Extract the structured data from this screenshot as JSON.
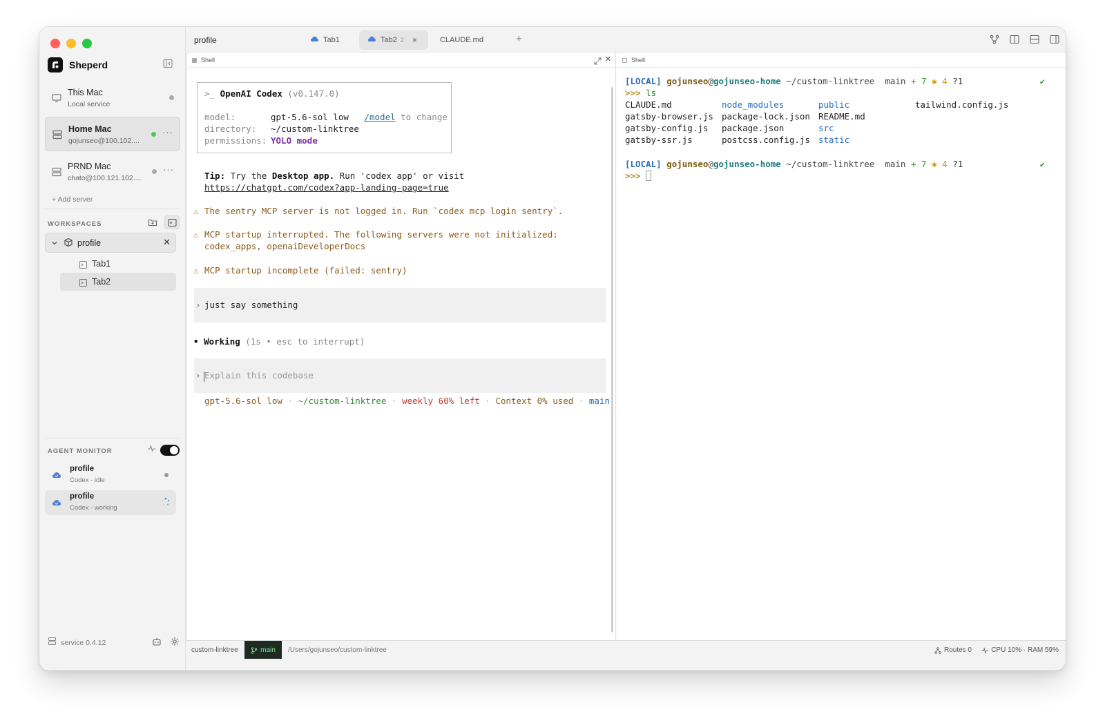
{
  "sidebar": {
    "brand": "Sheperd",
    "servers": [
      {
        "name": "This Mac",
        "sub": "Local service",
        "status": "idle"
      },
      {
        "name": "Home Mac",
        "sub": "gojunseo@100.102....",
        "status": "online"
      },
      {
        "name": "PRND Mac",
        "sub": "chato@100.121.102....",
        "status": "idle"
      }
    ],
    "add_server": "+ Add server",
    "workspaces_label": "WORKSPACES",
    "workspace": {
      "name": "profile",
      "tabs": [
        "Tab1",
        "Tab2"
      ]
    },
    "agent_monitor_label": "AGENT MONITOR",
    "agents": [
      {
        "name": "profile",
        "status": "Codex · idle"
      },
      {
        "name": "profile",
        "status": "Codex · working"
      }
    ],
    "footer_version": "service 0.4.12"
  },
  "topbar": {
    "workspace_title": "profile",
    "tabs": [
      {
        "label": "Tab1"
      },
      {
        "label": "Tab2",
        "badge": "2",
        "close": "×"
      },
      {
        "label": "CLAUDE.md"
      }
    ],
    "add": "+"
  },
  "left_pane": {
    "header": "Shell",
    "codex": {
      "title_prefix": ">_ ",
      "title": "OpenAI Codex",
      "version": "(v0.147.0)",
      "model_key": "model:",
      "model_val": "gpt-5.6-sol low",
      "model_link": "/model",
      "model_suffix": " to change",
      "dir_key": "directory:",
      "dir_val": "~/custom-linktree",
      "perm_key": "permissions:",
      "perm_val": "YOLO mode"
    },
    "tip": {
      "label": "Tip:",
      "pre": " Try the ",
      "app": "Desktop app.",
      "post": " Run 'codex app' or visit",
      "url": "https://chatgpt.com/codex?app-landing-page=true"
    },
    "warnings": [
      "The sentry MCP server is not logged in. Run `codex mcp login sentry`.",
      "MCP startup interrupted. The following servers were not initialized:",
      "codex_apps, openaiDeveloperDocs",
      "MCP startup incomplete (failed: sentry)"
    ],
    "user_message": "just say something",
    "working_label": "Working",
    "working_detail": " (1s • esc to interrupt)",
    "input_placeholder": "Explain this codebase",
    "status": {
      "model": "gpt-5.6-sol low",
      "dir": "~/custom-linktree",
      "weekly": "weekly 60% left",
      "context": "Context 0% used",
      "branch": "main",
      "sep": " · "
    }
  },
  "right_pane": {
    "header": "Shell",
    "prompt": {
      "local": "[LOCAL]",
      "user": "gojunseo",
      "at": "@",
      "host": "gojunseo-home",
      "path": " ~/custom-linktree",
      "branch_icon": "",
      "branch": " main",
      "plus": "+ 7",
      "star": "✱ 4",
      "q": "?1",
      "check": "✔",
      "arrow": ">>>"
    },
    "command": "ls",
    "files": [
      [
        "CLAUDE.md",
        "node_modules",
        "public",
        "tailwind.config.js"
      ],
      [
        "gatsby-browser.js",
        "package-lock.json",
        "README.md",
        ""
      ],
      [
        "gatsby-config.js",
        "package.json",
        "src",
        ""
      ],
      [
        "gatsby-ssr.js",
        "postcss.config.js",
        "static",
        ""
      ]
    ]
  },
  "statusbar": {
    "workspace": "custom-linktree",
    "branch": "main",
    "path": "/Users/gojunseo/custom-linktree",
    "routes": "Routes 0",
    "cpu": "CPU 10% · RAM 59%"
  },
  "colors": {
    "accent_dark": "#111111",
    "online": "#3ecf5a",
    "branch_bg": "#1f2a22",
    "branch_fg": "#7ee08a"
  }
}
